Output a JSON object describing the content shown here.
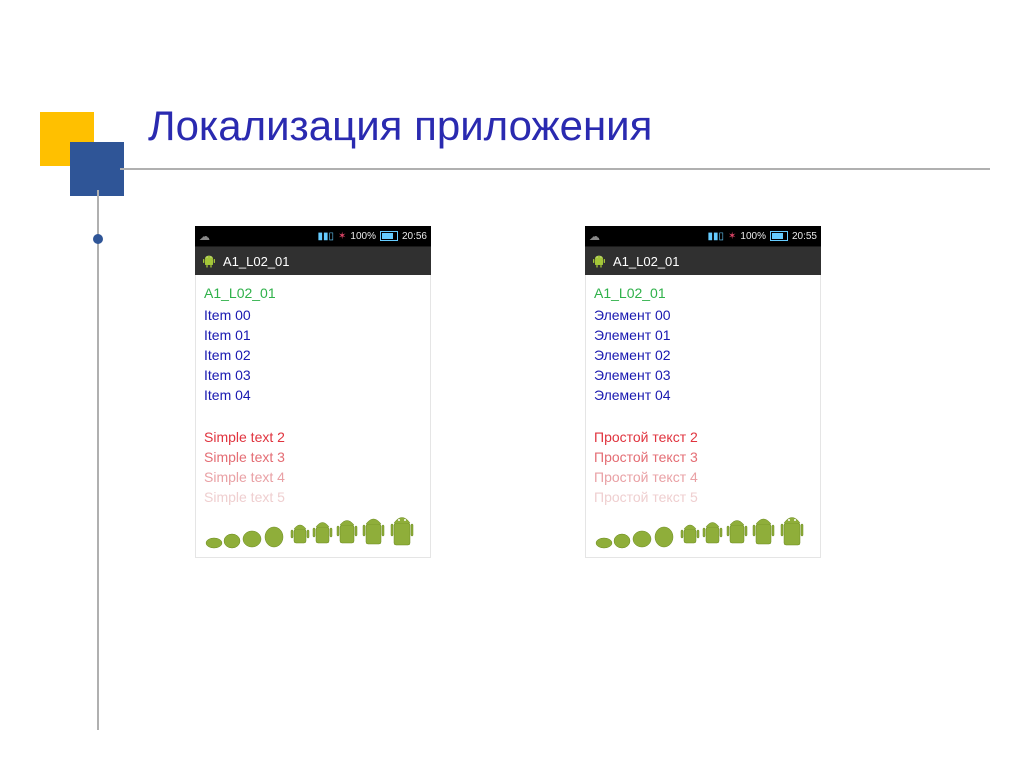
{
  "slide": {
    "title": "Локализация приложения"
  },
  "status": {
    "signal_icon": "▮▮▯",
    "star_icon": "✶",
    "battery_pct": "100%",
    "time_left": "20:56",
    "time_right": "20:55",
    "notif_icon": "☁"
  },
  "appbar": {
    "title": "A1_L02_01"
  },
  "content": {
    "header": "A1_L02_01"
  },
  "items_left": [
    "Item 00",
    "Item 01",
    "Item 02",
    "Item 03",
    "Item 04"
  ],
  "items_right": [
    "Элемент 00",
    "Элемент 01",
    "Элемент 02",
    "Элемент 03",
    "Элемент 04"
  ],
  "simple_left": [
    "Simple text 2",
    "Simple text 3",
    "Simple text 4",
    "Simple text 5"
  ],
  "simple_right": [
    "Простой текст 2",
    "Простой текст 3",
    "Простой текст 4",
    "Простой текст 5"
  ],
  "simple_colors": [
    "#e0333e",
    "#e46d74",
    "#e9a1a5",
    "#efcfd0"
  ]
}
